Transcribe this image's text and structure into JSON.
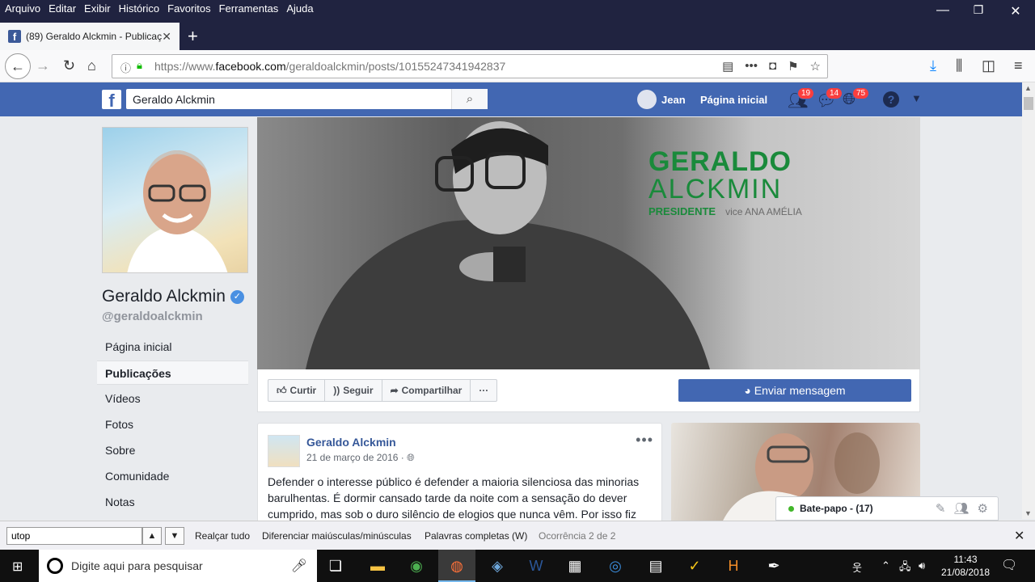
{
  "menubar": {
    "items": [
      "Arquivo",
      "Editar",
      "Exibir",
      "Histórico",
      "Favoritos",
      "Ferramentas",
      "Ajuda"
    ],
    "min": "—",
    "max": "❐",
    "close": "✕"
  },
  "tab": {
    "title": "(89) Geraldo Alckmin - Publicaç",
    "close": "✕",
    "newtab": "+"
  },
  "nav": {
    "url_prefix": "https://www.",
    "url_domain": "facebook.com",
    "url_path": "/geraldoalckmin/posts/10155247341942837"
  },
  "fb": {
    "search_value": "Geraldo Alckmin",
    "user_name": "Jean",
    "home": "Página inicial",
    "friend_requests": "19",
    "messages": "14",
    "notifications": "75"
  },
  "page": {
    "name": "Geraldo Alckmin",
    "handle": "@geraldoalckmin",
    "nav": [
      "Página inicial",
      "Publicações",
      "Vídeos",
      "Fotos",
      "Sobre",
      "Comunidade",
      "Notas"
    ]
  },
  "cover": {
    "brand_line1": "GERALDO",
    "brand_line2": "ALCKMIN",
    "brand_line3": "PRESIDENTE",
    "brand_vice": "vice ANA AMÉLIA"
  },
  "actions": {
    "like": "Curtir",
    "follow": "Seguir",
    "share": "Compartilhar",
    "more": "···",
    "message": "Enviar mensagem"
  },
  "post": {
    "author": "Geraldo Alckmin",
    "date": "21 de março de 2016 · ",
    "text": "Defender o interesse público é defender a maioria silenciosa das minorias barulhentas. É dormir cansado tarde da noite com a sensação do dever cumprido, mas sob o duro silêncio de elogios que nunca vêm. Por isso fiz"
  },
  "chat": {
    "label": "Bate-papo - (17)"
  },
  "find": {
    "value": "utop",
    "highlight": "Realçar tudo",
    "match_case": "Diferenciar maiúsculas/minúsculas",
    "whole_words": "Palavras completas (W)",
    "result": "Ocorrência 2 de 2"
  },
  "taskbar": {
    "search_placeholder": "Digite aqui para pesquisar",
    "time": "11:43",
    "date": "21/08/2018"
  }
}
